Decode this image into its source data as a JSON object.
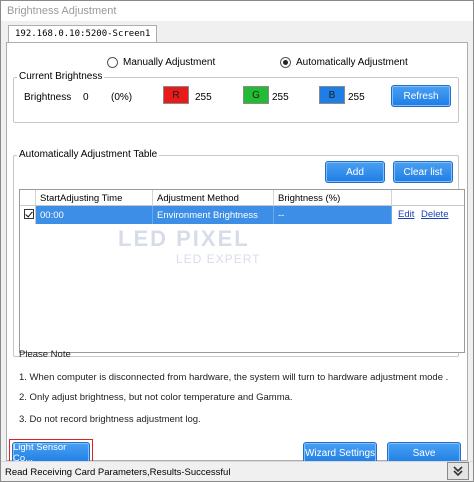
{
  "window": {
    "title": "Brightness Adjustment"
  },
  "tab": {
    "label": "192.168.0.10:5200-Screen1"
  },
  "mode": {
    "manual_label": "Manually Adjustment",
    "auto_label": "Automatically Adjustment",
    "selected": "auto"
  },
  "current_brightness": {
    "group_title": "Current Brightness",
    "label": "Brightness",
    "value": "0",
    "percent": "(0%)",
    "r_label": "R",
    "r_value": "255",
    "r_color": "#e81b1b",
    "g_label": "G",
    "g_value": "255",
    "g_color": "#22bb33",
    "b_label": "B",
    "b_value": "255",
    "b_color": "#1e7ee6",
    "refresh_label": "Refresh"
  },
  "auto_table": {
    "group_title": "Automatically Adjustment Table",
    "add_label": "Add",
    "clear_label": "Clear list",
    "columns": [
      "StartAdjusting Time",
      "Adjustment Method",
      "Brightness (%)"
    ],
    "rows": [
      {
        "time": "00:00",
        "method": "Environment Brightness",
        "brightness": "--",
        "edit": "Edit",
        "delete": "Delete",
        "checked": true
      }
    ],
    "watermark_line1": "LED PIXEL",
    "watermark_line2": "LED EXPERT"
  },
  "notes": {
    "title": "Please Note",
    "items": [
      "1. When computer is disconnected from hardware, the system will turn to hardware adjustment mode .",
      "2. Only adjust brightness, but not color temperature and Gamma.",
      "3. Do not record brightness adjustment log."
    ]
  },
  "footer": {
    "light_sensor_label": "Light Sensor Co...",
    "wizard_label": "Wizard Settings",
    "save_label": "Save"
  },
  "status": {
    "text": "Read Receiving Card Parameters,Results-Successful"
  },
  "accent_color": "#1e7ee6",
  "selection_color": "#3d8ee6"
}
